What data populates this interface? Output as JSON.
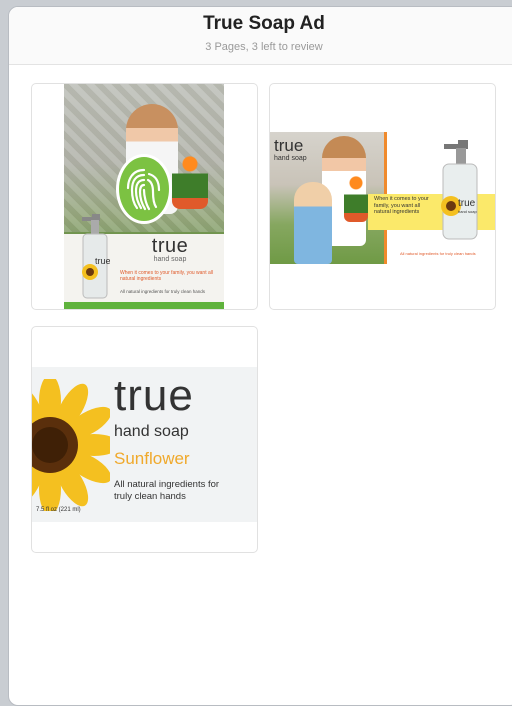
{
  "header": {
    "title": "True Soap Ad",
    "subtitle": "3 Pages, 3 left to review"
  },
  "page1": {
    "brand": "true",
    "sub": "hand soap",
    "bottle_brand": "true",
    "tagline": "When it comes to your family, you want all natural ingredients",
    "natural": "All natural ingredients for truly clean hands"
  },
  "page2": {
    "brand": "true",
    "sub": "hand soap",
    "tagline": "When it comes to your family, you want all natural ingredients",
    "bottle_brand": "true",
    "bottle_sub": "hand soap",
    "natural": "All natural ingredients for truly clean hands"
  },
  "page3": {
    "brand": "true",
    "sub": "hand soap",
    "flavor": "Sunflower",
    "natural": "All natural ingredients for truly clean hands",
    "size": "7.5 fl oz (221 ml)"
  },
  "colors": {
    "accent_green": "#7cc242",
    "sun_yellow": "#f4c020",
    "orange": "#f08a2c"
  }
}
